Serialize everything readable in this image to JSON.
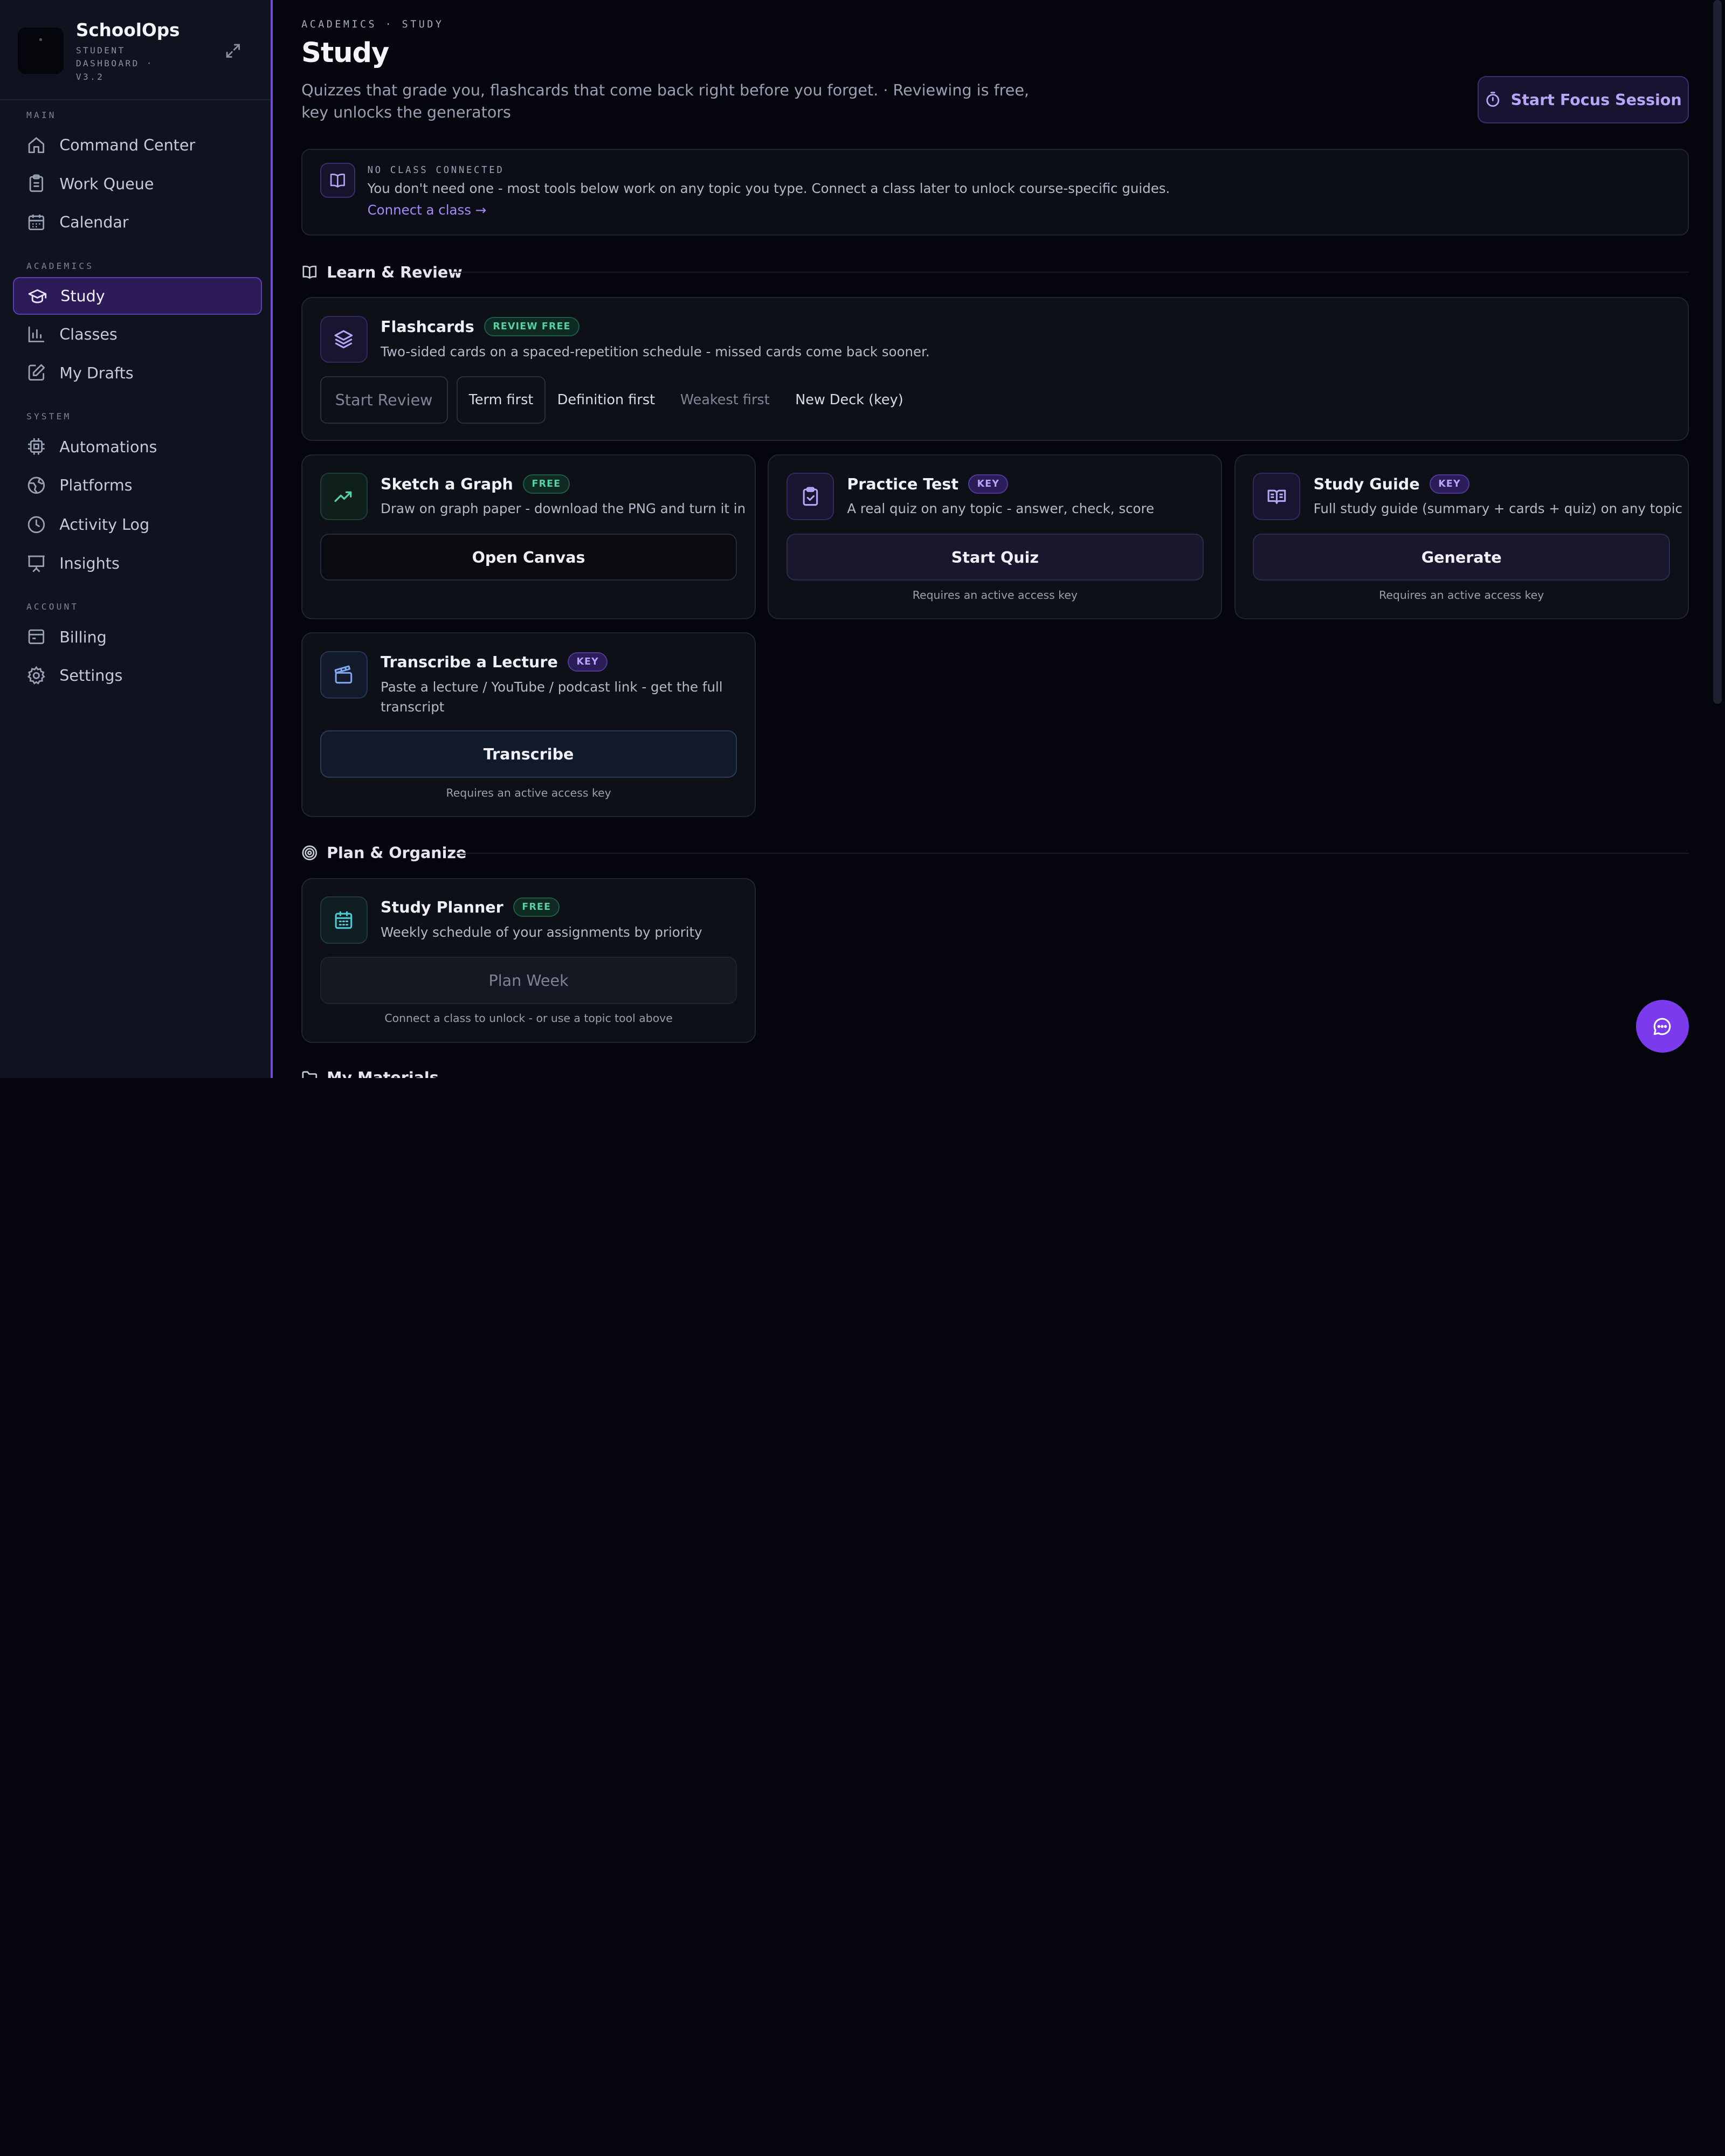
{
  "sidebar": {
    "brand_name": "SchoolOps",
    "brand_sub": "STUDENT DASHBOARD · V3.2",
    "sections": [
      {
        "label": "MAIN",
        "items": [
          "Command Center",
          "Work Queue",
          "Calendar"
        ]
      },
      {
        "label": "ACADEMICS",
        "items": [
          "Study",
          "Classes",
          "My Drafts"
        ]
      },
      {
        "label": "SYSTEM",
        "items": [
          "Automations",
          "Platforms",
          "Activity Log",
          "Insights"
        ]
      },
      {
        "label": "ACCOUNT",
        "items": [
          "Billing",
          "Settings"
        ]
      }
    ],
    "active_item": "Study"
  },
  "header": {
    "breadcrumb": "ACADEMICS · STUDY",
    "title": "Study",
    "subtitle": "Quizzes that grade you, flashcards that come back right before you forget.  · Reviewing is free, key unlocks the generators",
    "focus_button": "Start Focus Session"
  },
  "banner": {
    "tag": "NO CLASS CONNECTED",
    "text": "You don't need one - most tools below work on any topic you type. Connect a class later to unlock course-specific guides.",
    "link": "Connect a class →"
  },
  "sections": {
    "learn": "Learn & Review",
    "plan": "Plan & Organize",
    "materials": "My Materials"
  },
  "flashcards": {
    "title": "Flashcards",
    "badge": "REVIEW FREE",
    "desc": "Two-sided cards on a spaced-repetition schedule - missed cards come back sooner.",
    "start": "Start Review",
    "modes": [
      "Term first",
      "Definition first",
      "Weakest first",
      "New Deck (key)"
    ]
  },
  "tools": {
    "sketch": {
      "title": "Sketch a Graph",
      "badge": "FREE",
      "desc": "Draw on graph paper - download the PNG and turn it in",
      "button": "Open Canvas"
    },
    "practice": {
      "title": "Practice Test",
      "badge": "KEY",
      "desc": "A real quiz on any topic - answer, check, score",
      "button": "Start Quiz",
      "hint": "Requires an active access key"
    },
    "guide": {
      "title": "Study Guide",
      "badge": "KEY",
      "desc": "Full study guide (summary + cards + quiz) on any topic",
      "button": "Generate",
      "hint": "Requires an active access key"
    },
    "transcribe": {
      "title": "Transcribe a Lecture",
      "badge": "KEY",
      "desc": "Paste a lecture / YouTube / podcast link - get the full transcript",
      "button": "Transcribe",
      "hint": "Requires an active access key"
    },
    "planner": {
      "title": "Study Planner",
      "badge": "FREE",
      "desc": "Weekly schedule of your assignments by priority",
      "button": "Plan Week",
      "hint": "Connect a class to unlock - or use a topic tool above"
    }
  },
  "colors": {
    "accent": "#7c3aed",
    "background": "#05060d",
    "sidebar": "#0f1320",
    "free_badge": "#56d2a0",
    "key_badge": "#b9a5ff"
  }
}
